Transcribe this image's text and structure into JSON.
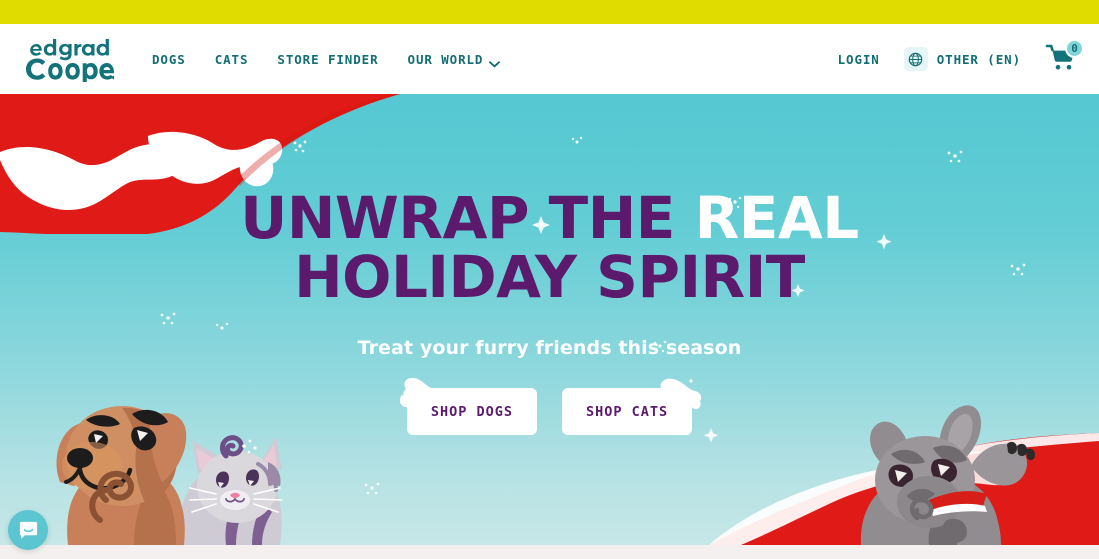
{
  "promo_bar": {
    "color": "#E0DC00",
    "text": ""
  },
  "header": {
    "logo": {
      "name": "edgard-cooper-logo",
      "line1": "edgard",
      "line2": "Cooper",
      "color": "#13737A"
    },
    "nav": [
      {
        "label": "Dogs",
        "icon": ""
      },
      {
        "label": "Cats",
        "icon": ""
      },
      {
        "label": "Store Finder",
        "icon": ""
      },
      {
        "label": "Our World",
        "icon": "chevron-down-icon"
      }
    ],
    "login_label": "Login",
    "language": {
      "icon": "globe-icon",
      "label": "Other (EN)"
    },
    "cart": {
      "icon": "shopping-cart-icon",
      "count": "0"
    },
    "text_color": "#136E73"
  },
  "hero": {
    "title_line1_a": "Unwrap the ",
    "title_line1_b": "Real",
    "title_line2": "Holiday Spirit",
    "subtitle": "Treat your furry friends this season",
    "buttons": [
      {
        "label": "Shop Dogs"
      },
      {
        "label": "Shop Cats"
      }
    ],
    "colors": {
      "purple": "#5B1A6B",
      "teal_top": "#55C8D1",
      "teal_bottom": "#C6E7E7",
      "red_paper": "#E01B17",
      "white": "#FFFFFF"
    },
    "art": {
      "top_left": "torn-red-wrapping-paper",
      "bottom_right": "torn-red-wrapping-paper",
      "left_pets": "dog-and-cat-illustration",
      "right_pet": "french-bulldog-illustration",
      "snowflakes": "snowflake-sparkles"
    }
  },
  "chat": {
    "icon": "chat-bubble-icon",
    "label": ""
  },
  "footer": {
    "background": "#F4F0F0"
  }
}
